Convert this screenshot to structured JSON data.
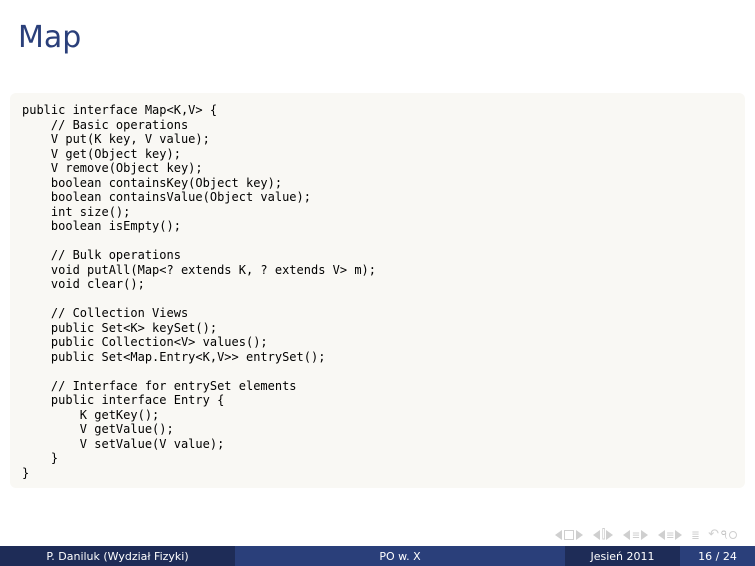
{
  "slide": {
    "title": "Map",
    "code": "public interface Map<K,V> {\n    // Basic operations\n    V put(K key, V value);\n    V get(Object key);\n    V remove(Object key);\n    boolean containsKey(Object key);\n    boolean containsValue(Object value);\n    int size();\n    boolean isEmpty();\n\n    // Bulk operations\n    void putAll(Map<? extends K, ? extends V> m);\n    void clear();\n\n    // Collection Views\n    public Set<K> keySet();\n    public Collection<V> values();\n    public Set<Map.Entry<K,V>> entrySet();\n\n    // Interface for entrySet elements\n    public interface Entry {\n        K getKey();\n        V getValue();\n        V setValue(V value);\n    }\n}"
  },
  "footer": {
    "author": "P. Daniluk (Wydział Fizyki)",
    "shortTitle": "PO w. X",
    "date": "Jesień 2011",
    "page": "16 / 24"
  },
  "nav": {
    "first": "first-slide",
    "prev": "previous-slide",
    "next": "next-slide",
    "last": "last-slide",
    "back": "go-back",
    "find": "search"
  }
}
